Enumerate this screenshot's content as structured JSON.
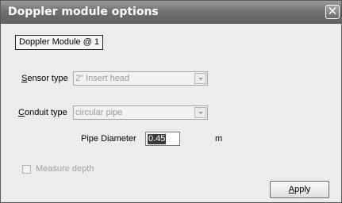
{
  "window": {
    "title": "Doppler module options",
    "close_glyph": "✕"
  },
  "module_label": "Doppler Module @ 1",
  "sensor": {
    "label_u": "S",
    "label_rest": "ensor type",
    "value": "2\" Insert head"
  },
  "conduit": {
    "label_u": "C",
    "label_rest": "onduit type",
    "value": "circular pipe"
  },
  "pipe": {
    "label": "Pipe Diameter",
    "value": "0.45",
    "unit": "m"
  },
  "measure_depth": {
    "label": "Measure depth",
    "checked": false
  },
  "apply": {
    "label_u": "A",
    "label_rest": "pply"
  }
}
